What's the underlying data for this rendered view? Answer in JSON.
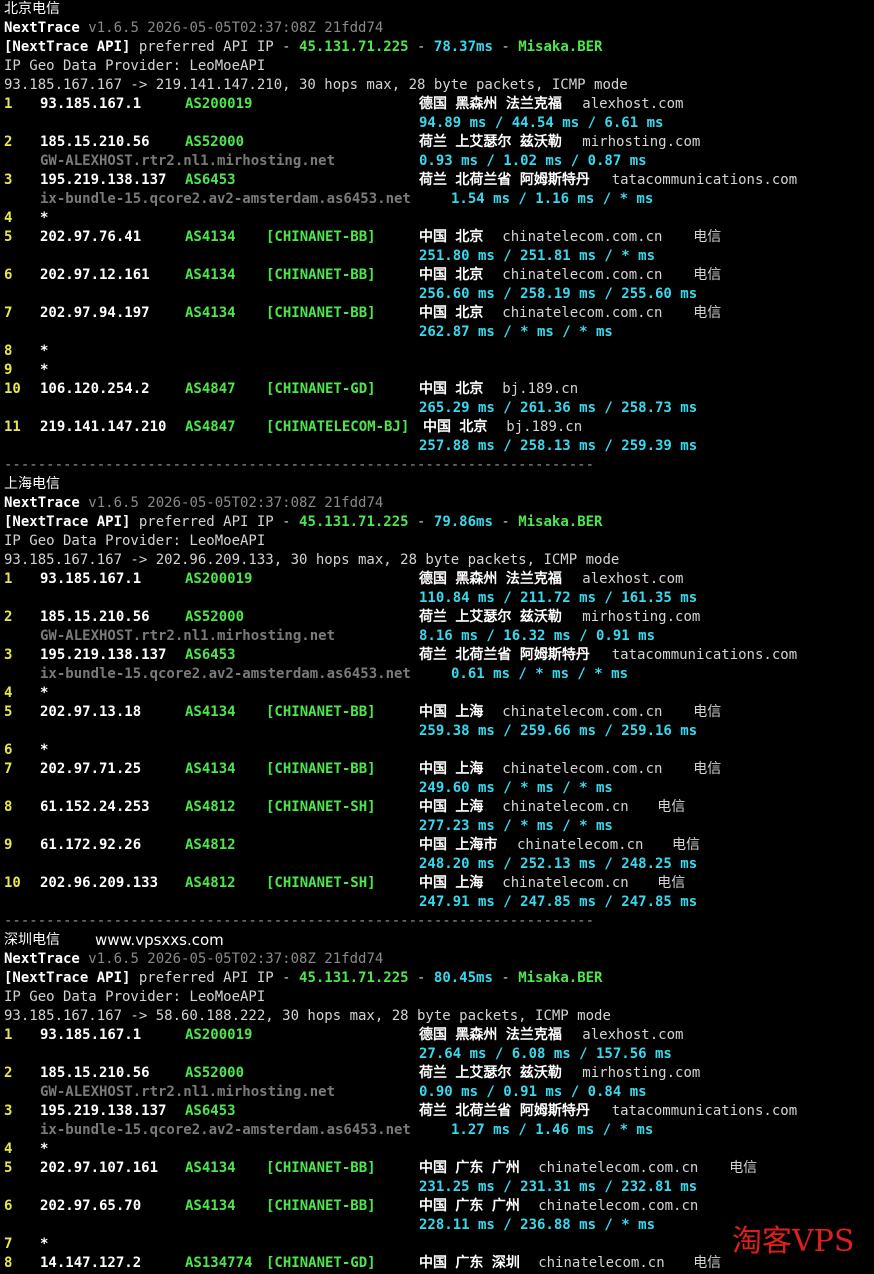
{
  "sections": [
    {
      "title": "北京电信",
      "site_url": "",
      "header": {
        "brand": "NextTrace",
        "version": "v1.6.5 2026-05-05T02:37:08Z 21fdd74",
        "api_tag": "[NextTrace API]",
        "api_text": " preferred API IP - ",
        "api_ip": "45.131.71.225",
        "api_sep1": " - ",
        "api_ms": "78.37ms",
        "api_sep2": " - ",
        "api_node": "Misaka.BER",
        "geo_provider": "IP Geo Data Provider: LeoMoeAPI",
        "route": "93.185.167.167 -> 219.141.147.210, 30 hops max, 28 byte packets, ICMP mode"
      },
      "hops": [
        {
          "num": "1",
          "ip": "93.185.167.1",
          "as": "AS200019",
          "tag": "",
          "geo": "德国 黑森州 法兰克福",
          "host": "alexhost.com",
          "isp": "",
          "rdns": "",
          "rtt": "94.89 ms / 44.54 ms / 6.61 ms"
        },
        {
          "num": "2",
          "ip": "185.15.210.56",
          "as": "AS52000",
          "tag": "",
          "geo": "荷兰 上艾瑟尔 兹沃勒",
          "host": "mirhosting.com",
          "isp": "",
          "rdns": "GW-ALEXHOST.rtr2.nl1.mirhosting.net",
          "rtt": "0.93 ms / 1.02 ms / 0.87 ms"
        },
        {
          "num": "3",
          "ip": "195.219.138.137",
          "as": "AS6453",
          "tag": "",
          "geo": "荷兰 北荷兰省 阿姆斯特丹",
          "host": "tatacommunications.com",
          "isp": "",
          "rdns": "ix-bundle-15.qcore2.av2-amsterdam.as6453.net",
          "rtt": "1.54 ms / 1.16 ms / * ms"
        },
        {
          "num": "4",
          "ip": "*"
        },
        {
          "num": "5",
          "ip": "202.97.76.41",
          "as": "AS4134",
          "tag": "[CHINANET-BB]",
          "geo": "中国 北京",
          "host": "chinatelecom.com.cn",
          "isp": "电信",
          "rdns": "",
          "rtt": "251.80 ms / 251.81 ms / * ms"
        },
        {
          "num": "6",
          "ip": "202.97.12.161",
          "as": "AS4134",
          "tag": "[CHINANET-BB]",
          "geo": "中国 北京",
          "host": "chinatelecom.com.cn",
          "isp": "电信",
          "rdns": "",
          "rtt": "256.60 ms / 258.19 ms / 255.60 ms"
        },
        {
          "num": "7",
          "ip": "202.97.94.197",
          "as": "AS4134",
          "tag": "[CHINANET-BB]",
          "geo": "中国 北京",
          "host": "chinatelecom.com.cn",
          "isp": "电信",
          "rdns": "",
          "rtt": "262.87 ms / * ms / * ms"
        },
        {
          "num": "8",
          "ip": "*"
        },
        {
          "num": "9",
          "ip": "*"
        },
        {
          "num": "10",
          "ip": "106.120.254.2",
          "as": "AS4847",
          "tag": "[CHINANET-GD]",
          "geo": "中国 北京",
          "host": "bj.189.cn",
          "isp": "",
          "rdns": "",
          "rtt": "265.29 ms / 261.36 ms / 258.73 ms"
        },
        {
          "num": "11",
          "ip": "219.141.147.210",
          "as": "AS4847",
          "tag": "[CHINATELECOM-BJ]",
          "geo": "中国 北京",
          "host": "bj.189.cn",
          "isp": "",
          "rdns": "",
          "rtt": "257.88 ms / 258.13 ms / 259.39 ms"
        }
      ],
      "divider": "----------------------------------------------------------------------"
    },
    {
      "title": "上海电信",
      "site_url": "",
      "header": {
        "brand": "NextTrace",
        "version": "v1.6.5 2026-05-05T02:37:08Z 21fdd74",
        "api_tag": "[NextTrace API]",
        "api_text": " preferred API IP - ",
        "api_ip": "45.131.71.225",
        "api_sep1": " - ",
        "api_ms": "79.86ms",
        "api_sep2": " - ",
        "api_node": "Misaka.BER",
        "geo_provider": "IP Geo Data Provider: LeoMoeAPI",
        "route": "93.185.167.167 -> 202.96.209.133, 30 hops max, 28 byte packets, ICMP mode"
      },
      "hops": [
        {
          "num": "1",
          "ip": "93.185.167.1",
          "as": "AS200019",
          "tag": "",
          "geo": "德国 黑森州 法兰克福",
          "host": "alexhost.com",
          "isp": "",
          "rdns": "",
          "rtt": "110.84 ms / 211.72 ms / 161.35 ms"
        },
        {
          "num": "2",
          "ip": "185.15.210.56",
          "as": "AS52000",
          "tag": "",
          "geo": "荷兰 上艾瑟尔 兹沃勒",
          "host": "mirhosting.com",
          "isp": "",
          "rdns": "GW-ALEXHOST.rtr2.nl1.mirhosting.net",
          "rtt": "8.16 ms / 16.32 ms / 0.91 ms"
        },
        {
          "num": "3",
          "ip": "195.219.138.137",
          "as": "AS6453",
          "tag": "",
          "geo": "荷兰 北荷兰省 阿姆斯特丹",
          "host": "tatacommunications.com",
          "isp": "",
          "rdns": "ix-bundle-15.qcore2.av2-amsterdam.as6453.net",
          "rtt": "0.61 ms / * ms / * ms"
        },
        {
          "num": "4",
          "ip": "*"
        },
        {
          "num": "5",
          "ip": "202.97.13.18",
          "as": "AS4134",
          "tag": "[CHINANET-BB]",
          "geo": "中国 上海",
          "host": "chinatelecom.com.cn",
          "isp": "电信",
          "rdns": "",
          "rtt": "259.38 ms / 259.66 ms / 259.16 ms"
        },
        {
          "num": "6",
          "ip": "*"
        },
        {
          "num": "7",
          "ip": "202.97.71.25",
          "as": "AS4134",
          "tag": "[CHINANET-BB]",
          "geo": "中国 上海",
          "host": "chinatelecom.com.cn",
          "isp": "电信",
          "rdns": "",
          "rtt": "249.60 ms / * ms / * ms"
        },
        {
          "num": "8",
          "ip": "61.152.24.253",
          "as": "AS4812",
          "tag": "[CHINANET-SH]",
          "geo": "中国 上海",
          "host": "chinatelecom.cn",
          "isp": "电信",
          "rdns": "",
          "rtt": "277.23 ms / * ms / * ms"
        },
        {
          "num": "9",
          "ip": "61.172.92.26",
          "as": "AS4812",
          "tag": "",
          "geo": "中国 上海市",
          "host": "chinatelecom.cn",
          "isp": "电信",
          "rdns": "",
          "rtt": "248.20 ms / 252.13 ms / 248.25 ms"
        },
        {
          "num": "10",
          "ip": "202.96.209.133",
          "as": "AS4812",
          "tag": "[CHINANET-SH]",
          "geo": "中国 上海",
          "host": "chinatelecom.cn",
          "isp": "电信",
          "rdns": "",
          "rtt": "247.91 ms / 247.85 ms / 247.85 ms"
        }
      ],
      "divider": "----------------------------------------------------------------------"
    },
    {
      "title": "深圳电信",
      "site_url": "www.vpsxxs.com",
      "header": {
        "brand": "NextTrace",
        "version": "v1.6.5 2026-05-05T02:37:08Z 21fdd74",
        "api_tag": "[NextTrace API]",
        "api_text": " preferred API IP - ",
        "api_ip": "45.131.71.225",
        "api_sep1": " - ",
        "api_ms": "80.45ms",
        "api_sep2": " - ",
        "api_node": "Misaka.BER",
        "geo_provider": "IP Geo Data Provider: LeoMoeAPI",
        "route": "93.185.167.167 -> 58.60.188.222, 30 hops max, 28 byte packets, ICMP mode"
      },
      "hops": [
        {
          "num": "1",
          "ip": "93.185.167.1",
          "as": "AS200019",
          "tag": "",
          "geo": "德国 黑森州 法兰克福",
          "host": "alexhost.com",
          "isp": "",
          "rdns": "",
          "rtt": "27.64 ms / 6.08 ms / 157.56 ms"
        },
        {
          "num": "2",
          "ip": "185.15.210.56",
          "as": "AS52000",
          "tag": "",
          "geo": "荷兰 上艾瑟尔 兹沃勒",
          "host": "mirhosting.com",
          "isp": "",
          "rdns": "GW-ALEXHOST.rtr2.nl1.mirhosting.net",
          "rtt": "0.90 ms / 0.91 ms / 0.84 ms"
        },
        {
          "num": "3",
          "ip": "195.219.138.137",
          "as": "AS6453",
          "tag": "",
          "geo": "荷兰 北荷兰省 阿姆斯特丹",
          "host": "tatacommunications.com",
          "isp": "",
          "rdns": "ix-bundle-15.qcore2.av2-amsterdam.as6453.net",
          "rtt": "1.27 ms / 1.46 ms / * ms"
        },
        {
          "num": "4",
          "ip": "*"
        },
        {
          "num": "5",
          "ip": "202.97.107.161",
          "as": "AS4134",
          "tag": "[CHINANET-BB]",
          "geo": "中国 广东 广州",
          "host": "chinatelecom.com.cn",
          "isp": "电信",
          "rdns": "",
          "rtt": "231.25 ms / 231.31 ms / 232.81 ms"
        },
        {
          "num": "6",
          "ip": "202.97.65.70",
          "as": "AS4134",
          "tag": "[CHINANET-BB]",
          "geo": "中国 广东 广州",
          "host": "chinatelecom.com.cn",
          "isp": "",
          "rdns": "",
          "rtt": "228.11 ms / 236.88 ms / * ms"
        },
        {
          "num": "7",
          "ip": "*"
        },
        {
          "num": "8",
          "ip": "14.147.127.2",
          "as": "AS134774",
          "tag": "[CHINANET-GD]",
          "geo": "中国 广东 深圳",
          "host": "chinatelecom.cn",
          "isp": "电信",
          "rdns": "",
          "rtt": ""
        }
      ],
      "divider": ""
    }
  ],
  "watermark": "淘客VPS",
  "colors": {
    "background": "#000000",
    "hop_number": "#e8e84a",
    "asn": "#4ee64e",
    "latency": "#38d9ee",
    "rdns": "#7a7a7a"
  }
}
